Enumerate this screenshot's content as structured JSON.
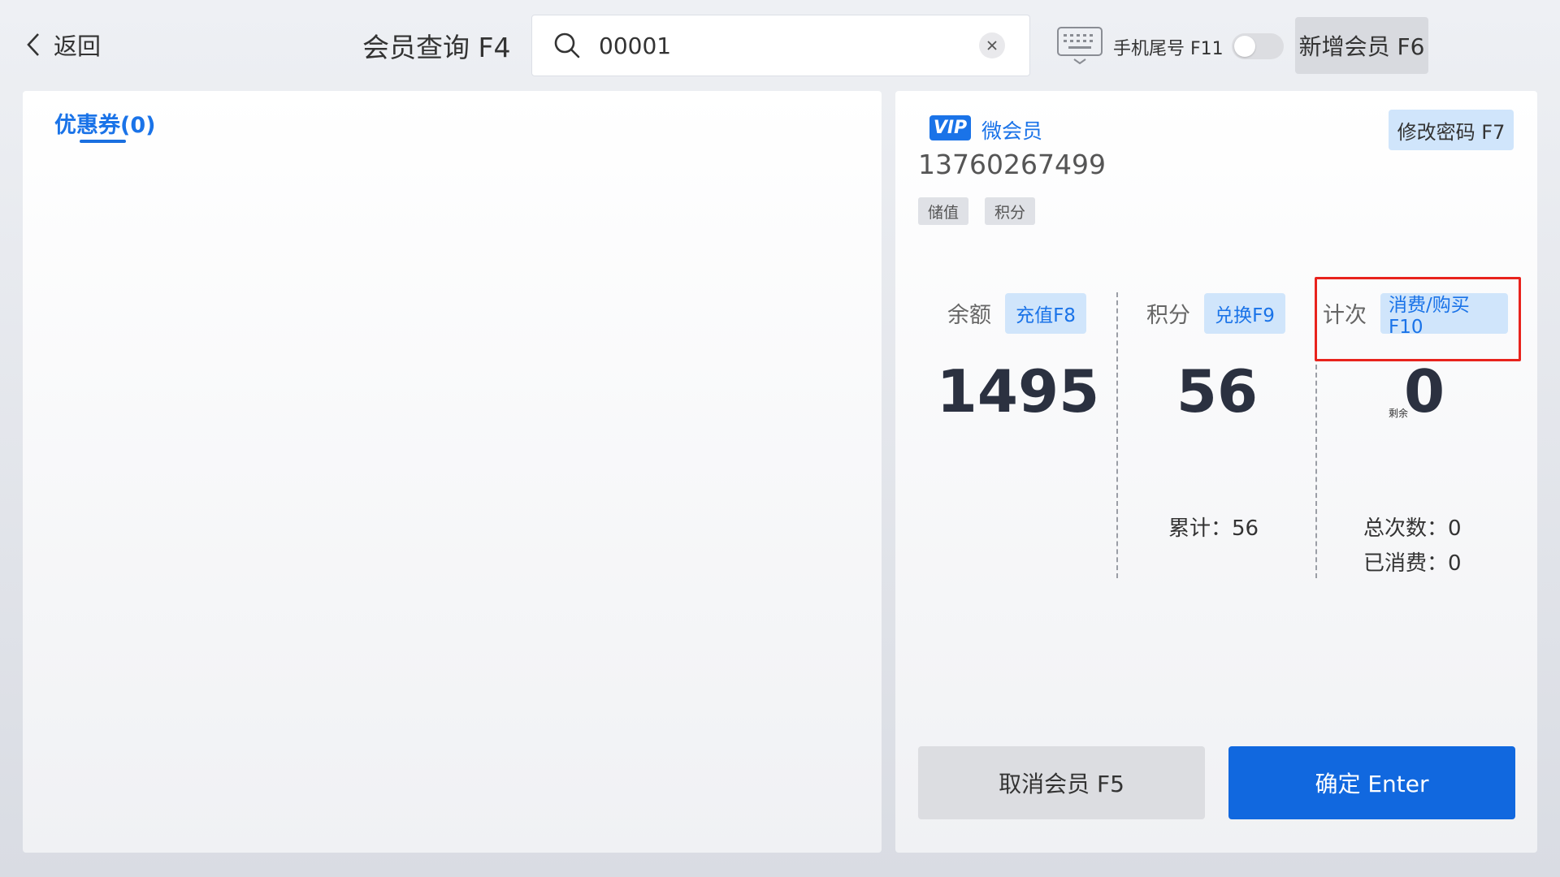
{
  "header": {
    "back_label": "返回",
    "query_label": "会员查询 F4",
    "search_value": "00001",
    "phone_tail_label": "手机尾号 F11",
    "phone_tail_enabled": false,
    "add_member_label": "新增会员 F6"
  },
  "left": {
    "coupon_tab_label": "优惠券(0)"
  },
  "member": {
    "badge": "VIP",
    "type": "微会员",
    "phone": "13760267499",
    "tags": [
      "储值",
      "积分"
    ],
    "change_password_label": "修改密码 F7"
  },
  "stats": {
    "balance": {
      "label": "余额",
      "action": "充值F8",
      "value": "1495"
    },
    "points": {
      "label": "积分",
      "action": "兑换F9",
      "value": "56",
      "total": "累计：56"
    },
    "count": {
      "label": "计次",
      "action": "消费/购买F10",
      "remain_label": "剩余",
      "value": "0",
      "total_count": "总次数：0",
      "consumed": "已消费：0"
    }
  },
  "footer": {
    "cancel_label": "取消会员 F5",
    "confirm_label": "确定 Enter"
  },
  "colors": {
    "accent": "#1a73e8",
    "highlight": "#e8231d",
    "confirm_bg": "#1168df"
  }
}
